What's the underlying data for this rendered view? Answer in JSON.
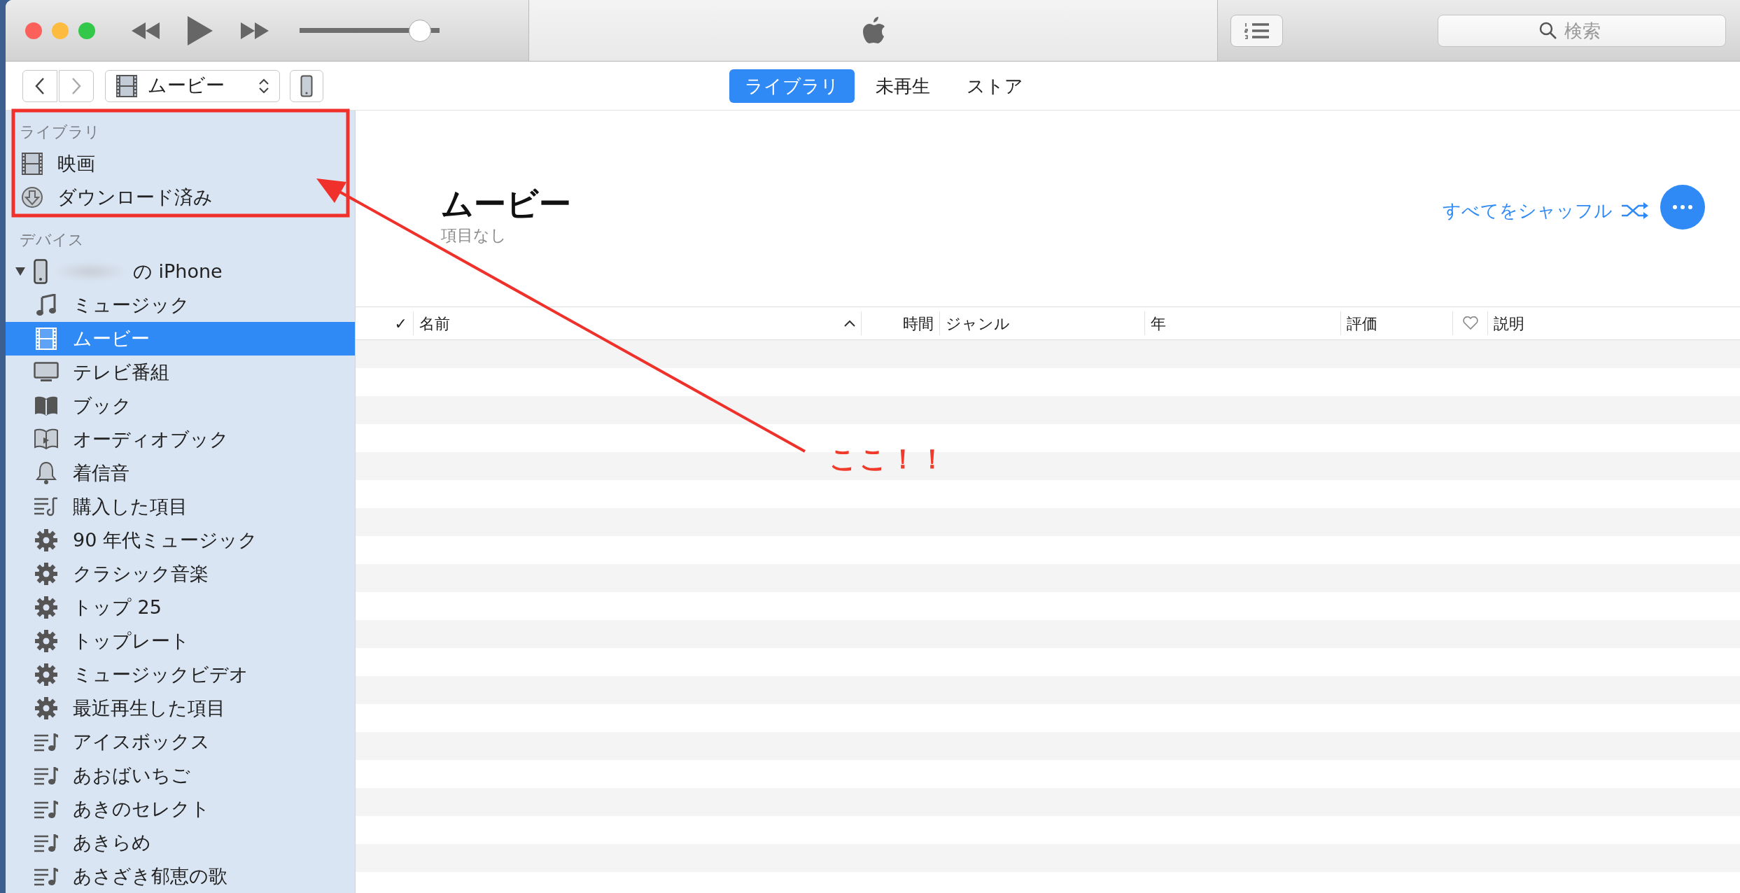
{
  "titlebar": {
    "volume": {
      "level": 0.93
    },
    "search": {
      "placeholder": "検索"
    }
  },
  "toolbar": {
    "back": {
      "disabled": false
    },
    "forward": {
      "disabled": true
    },
    "media_picker": {
      "kind": "film",
      "label": "ムービー"
    },
    "tabs": [
      {
        "label": "ライブラリ",
        "selected": true
      },
      {
        "label": "未再生",
        "selected": false
      },
      {
        "label": "ストア",
        "selected": false
      }
    ]
  },
  "sidebar": {
    "library": {
      "title": "ライブラリ",
      "items": [
        {
          "kind": "film",
          "label": "映画",
          "selected": false
        },
        {
          "kind": "download",
          "label": "ダウンロード済み",
          "selected": false
        }
      ]
    },
    "devices": {
      "title": "デバイス",
      "device": {
        "name": "の iPhone",
        "expanded": true,
        "children": [
          {
            "kind": "music",
            "label": "ミュージック",
            "selected": false
          },
          {
            "kind": "film",
            "label": "ムービー",
            "selected": true
          },
          {
            "kind": "tv",
            "label": "テレビ番組",
            "selected": false
          },
          {
            "kind": "book",
            "label": "ブック",
            "selected": false
          },
          {
            "kind": "audiobook",
            "label": "オーディオブック",
            "selected": false
          },
          {
            "kind": "bell",
            "label": "着信音",
            "selected": false
          },
          {
            "kind": "purchased",
            "label": "購入した項目",
            "selected": false
          },
          {
            "kind": "gear",
            "label": "90 年代ミュージック",
            "selected": false
          },
          {
            "kind": "gear",
            "label": "クラシック音楽",
            "selected": false
          },
          {
            "kind": "gear",
            "label": "トップ 25",
            "selected": false
          },
          {
            "kind": "gear",
            "label": "トップレート",
            "selected": false
          },
          {
            "kind": "gear",
            "label": "ミュージックビデオ",
            "selected": false
          },
          {
            "kind": "gear",
            "label": "最近再生した項目",
            "selected": false
          },
          {
            "kind": "playlist",
            "label": "アイスボックス",
            "selected": false
          },
          {
            "kind": "playlist",
            "label": "あおばいちご",
            "selected": false
          },
          {
            "kind": "playlist",
            "label": "あきのセレクト",
            "selected": false
          },
          {
            "kind": "playlist",
            "label": "あきらめ",
            "selected": false
          },
          {
            "kind": "playlist",
            "label": "あさざき郁恵の歌",
            "selected": false
          }
        ]
      }
    }
  },
  "content": {
    "title": "ムービー",
    "subtitle": "項目なし",
    "shuffle": "すべてをシャッフル",
    "table": {
      "columns": [
        {
          "kind": "check",
          "label": "✓"
        },
        {
          "kind": "sorted",
          "label": "名前"
        },
        {
          "kind": "right",
          "label": "時間"
        },
        {
          "kind": "text",
          "label": "ジャンル"
        },
        {
          "kind": "text",
          "label": "年"
        },
        {
          "kind": "text",
          "label": "評価"
        },
        {
          "kind": "heart"
        },
        {
          "kind": "text",
          "label": "説明"
        }
      ]
    }
  },
  "annotation": {
    "label": "ここ！！"
  }
}
